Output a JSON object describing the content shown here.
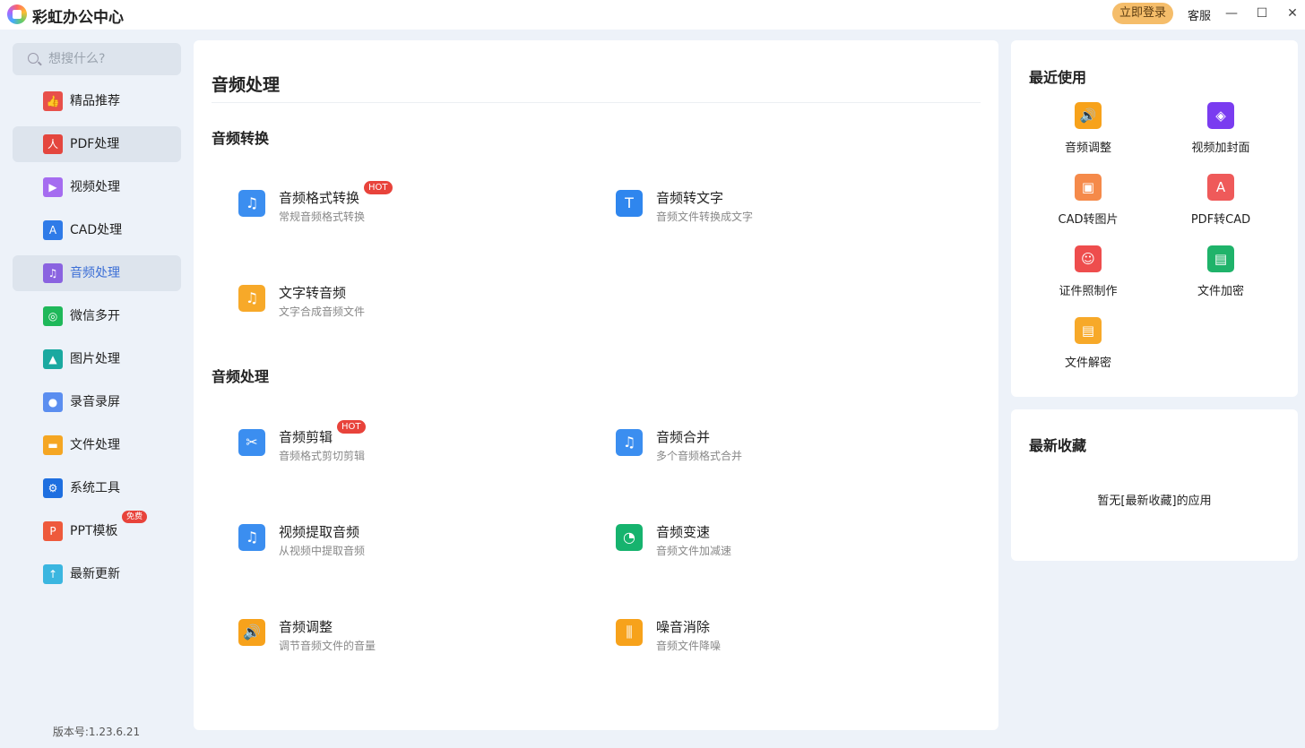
{
  "app": {
    "title": "彩虹办公中心",
    "login": "立即登录",
    "service": "客服",
    "minimize": "—",
    "maximize": "☐",
    "close": "✕"
  },
  "sidebar": {
    "search_placeholder": "想搜什么?",
    "version": "版本号:1.23.6.21",
    "items": [
      {
        "label": "精品推荐",
        "icon": "thumbs-up-icon",
        "color": "#e8504a",
        "glyph": "👍"
      },
      {
        "label": "PDF处理",
        "icon": "pdf-icon",
        "color": "#e4463e",
        "glyph": "人"
      },
      {
        "label": "视频处理",
        "icon": "video-play-icon",
        "color": "#a56cf0",
        "glyph": "▶"
      },
      {
        "label": "CAD处理",
        "icon": "cad-icon",
        "color": "#2f7be8",
        "glyph": "A"
      },
      {
        "label": "音频处理",
        "icon": "music-note-icon",
        "color": "#8a63e0",
        "glyph": "♫"
      },
      {
        "label": "微信多开",
        "icon": "wechat-icon",
        "color": "#1fb85a",
        "glyph": "◎"
      },
      {
        "label": "图片处理",
        "icon": "image-icon",
        "color": "#1aa9a0",
        "glyph": "▲"
      },
      {
        "label": "录音录屏",
        "icon": "microphone-icon",
        "color": "#5b8ef0",
        "glyph": "●"
      },
      {
        "label": "文件处理",
        "icon": "folder-icon",
        "color": "#f5a623",
        "glyph": "▬"
      },
      {
        "label": "系统工具",
        "icon": "gear-icon",
        "color": "#1e6fe0",
        "glyph": "⚙"
      },
      {
        "label": "PPT模板",
        "icon": "ppt-icon",
        "color": "#ee5a3c",
        "glyph": "P",
        "badge": "免费"
      },
      {
        "label": "最新更新",
        "icon": "upload-icon",
        "color": "#3bb6e0",
        "glyph": "↑"
      }
    ]
  },
  "main": {
    "title": "音频处理",
    "sections": [
      {
        "title": "音频转换",
        "tools": [
          {
            "name": "音频格式转换",
            "desc": "常规音频格式转换",
            "badge": "HOT",
            "icon": "audio-convert-icon",
            "color": "#3b8ef0",
            "glyph": "♫"
          },
          {
            "name": "音频转文字",
            "desc": "音频文件转换成文字",
            "icon": "audio-to-text-icon",
            "color": "#2f86ee",
            "glyph": "T"
          },
          {
            "name": "文字转音频",
            "desc": "文字合成音频文件",
            "icon": "text-to-audio-icon",
            "color": "#f7a929",
            "glyph": "♫"
          }
        ]
      },
      {
        "title": "音频处理",
        "tools": [
          {
            "name": "音频剪辑",
            "desc": "音频格式剪切剪辑",
            "badge": "HOT",
            "icon": "audio-cut-icon",
            "color": "#3b8ef0",
            "glyph": "✂"
          },
          {
            "name": "音频合并",
            "desc": "多个音频格式合并",
            "icon": "audio-merge-icon",
            "color": "#3b8ef0",
            "glyph": "♫"
          },
          {
            "name": "视频提取音频",
            "desc": "从视频中提取音频",
            "icon": "video-extract-audio-icon",
            "color": "#3b8ef0",
            "glyph": "♫"
          },
          {
            "name": "音频变速",
            "desc": "音频文件加减速",
            "icon": "audio-speed-icon",
            "color": "#16b36e",
            "glyph": "◔"
          },
          {
            "name": "音频调整",
            "desc": "调节音频文件的音量",
            "icon": "volume-icon",
            "color": "#f7a21b",
            "glyph": "🔊"
          },
          {
            "name": "噪音消除",
            "desc": "音频文件降噪",
            "icon": "noise-reduction-icon",
            "color": "#f7a21b",
            "glyph": "⫼"
          }
        ]
      }
    ]
  },
  "recent": {
    "title": "最近使用",
    "items": [
      {
        "label": "音频调整",
        "icon": "volume-icon",
        "color": "#f7a21b",
        "glyph": "🔊"
      },
      {
        "label": "视频加封面",
        "icon": "video-cover-icon",
        "color": "#7a3cf0",
        "glyph": "◈"
      },
      {
        "label": "CAD转图片",
        "icon": "cad-to-image-icon",
        "color": "#f58a4a",
        "glyph": "▣"
      },
      {
        "label": "PDF转CAD",
        "icon": "pdf-to-cad-icon",
        "color": "#ef5a5a",
        "glyph": "A"
      },
      {
        "label": "证件照制作",
        "icon": "id-photo-icon",
        "color": "#ee4d4d",
        "glyph": "☺"
      },
      {
        "label": "文件加密",
        "icon": "file-lock-icon",
        "color": "#1fb36a",
        "glyph": "▤"
      },
      {
        "label": "文件解密",
        "icon": "file-unlock-icon",
        "color": "#f7a929",
        "glyph": "▤"
      }
    ]
  },
  "favorites": {
    "title": "最新收藏",
    "empty": "暂无[最新收藏]的应用"
  }
}
